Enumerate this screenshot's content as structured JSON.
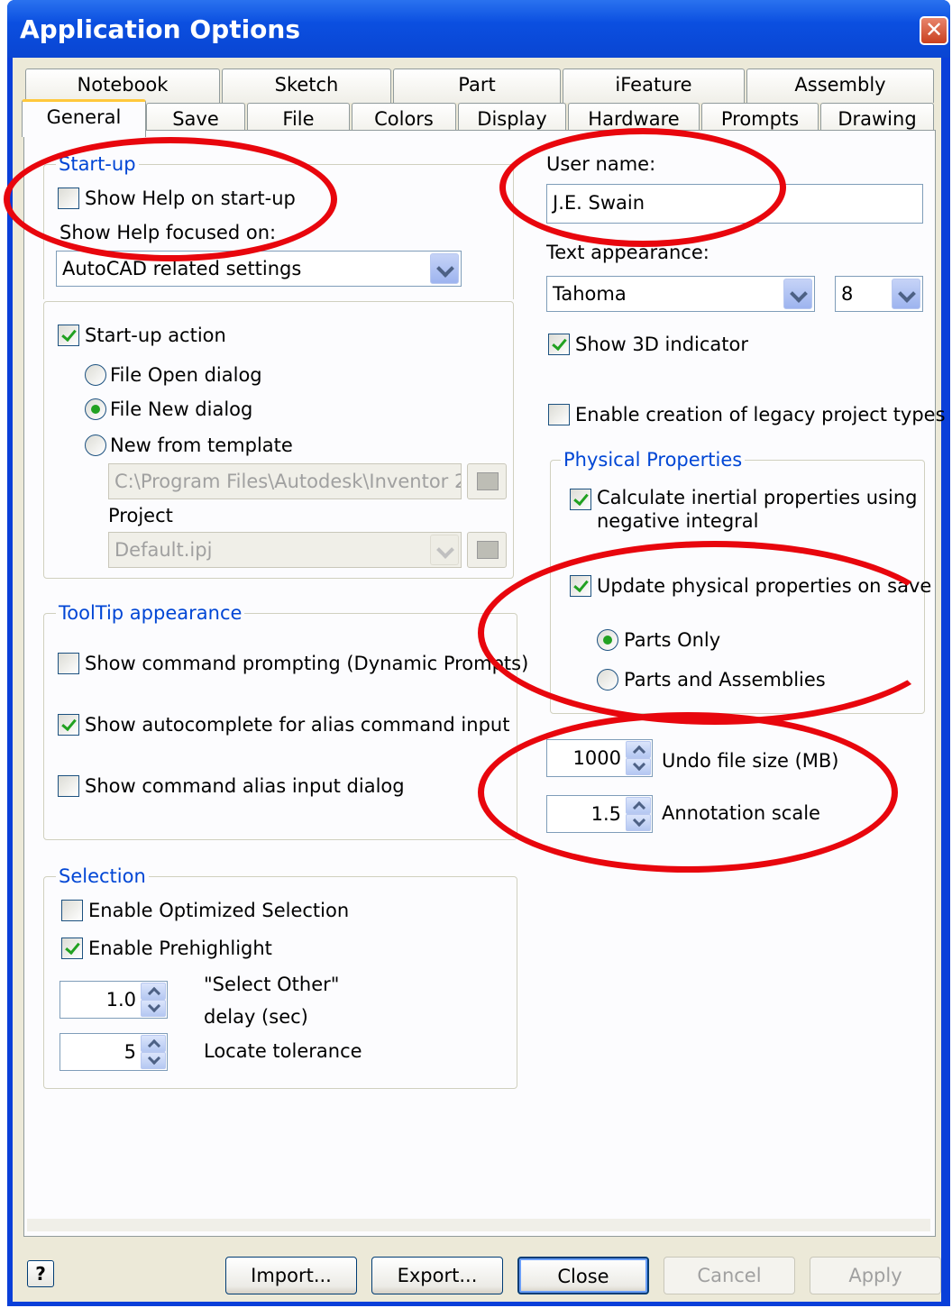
{
  "window": {
    "title": "Application Options",
    "close_symbol": "✕"
  },
  "tabs_row1": [
    "Notebook",
    "Sketch",
    "Part",
    "iFeature",
    "Assembly"
  ],
  "tabs_row2": [
    "General",
    "Save",
    "File",
    "Colors",
    "Display",
    "Hardware",
    "Prompts",
    "Drawing"
  ],
  "active_tab": "General",
  "startup": {
    "group_label": "Start-up",
    "show_help_label": "Show Help on start-up",
    "show_help_checked": false,
    "focused_label": "Show Help focused on:",
    "focused_value": "AutoCAD related settings",
    "action_label": "Start-up action",
    "action_checked": true,
    "radio_open": "File Open dialog",
    "radio_new": "File New dialog",
    "radio_template": "New from template",
    "selected_radio": "File New dialog",
    "template_path": "C:\\Program Files\\Autodesk\\Inventor 2",
    "project_label": "Project",
    "project_value": "Default.ipj"
  },
  "tooltip": {
    "group_label": "ToolTip appearance",
    "dynamic_prompts": "Show command prompting (Dynamic Prompts)",
    "dynamic_prompts_checked": false,
    "autocomplete": "Show autocomplete for alias command input",
    "autocomplete_checked": true,
    "alias_dialog": "Show command alias input dialog",
    "alias_dialog_checked": false
  },
  "selection": {
    "group_label": "Selection",
    "optimized": "Enable Optimized Selection",
    "optimized_checked": false,
    "prehighlight": "Enable Prehighlight",
    "prehighlight_checked": true,
    "select_other_value": "1.0",
    "select_other_label_1": "\"Select Other\"",
    "select_other_label_2": "delay (sec)",
    "locate_value": "5",
    "locate_label": "Locate tolerance"
  },
  "right": {
    "user_name_label": "User name:",
    "user_name_value": "J.E. Swain",
    "text_appearance_label": "Text appearance:",
    "font_value": "Tahoma",
    "size_value": "8",
    "show_3d": "Show 3D indicator",
    "show_3d_checked": true,
    "legacy": "Enable creation of legacy project types",
    "legacy_checked": false
  },
  "physical": {
    "group_label": "Physical Properties",
    "inertial_1": "Calculate inertial properties using",
    "inertial_2": "negative integral",
    "inertial_checked": true,
    "update": "Update physical properties on save",
    "update_checked": true,
    "parts_only": "Parts Only",
    "parts_assemblies": "Parts and Assemblies",
    "selected": "Parts Only"
  },
  "undo": {
    "value": "1000",
    "label": "Undo file size (MB)"
  },
  "annotation": {
    "value": "1.5",
    "label": "Annotation scale"
  },
  "buttons": {
    "help": "?",
    "import": "Import...",
    "export": "Export...",
    "close": "Close",
    "cancel": "Cancel",
    "apply": "Apply"
  },
  "colors": {
    "highlight_ellipse": "#e8060d",
    "title_bar": "#0a45d2",
    "group_label": "#0046d5"
  }
}
